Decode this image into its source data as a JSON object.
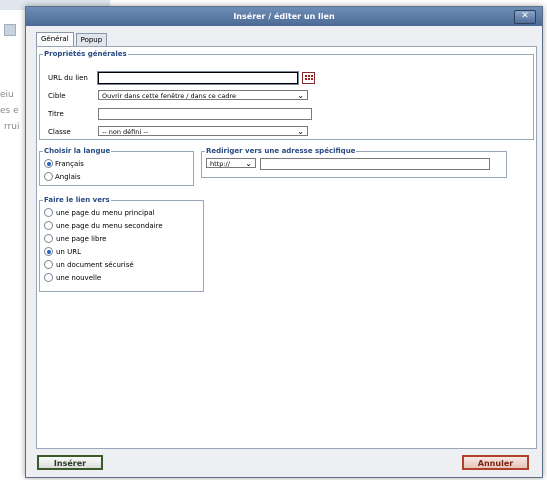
{
  "background": {
    "fragments": [
      "eiu",
      "es e",
      "rrui"
    ]
  },
  "dialog": {
    "title": "Insérer / éditer un lien",
    "close_label": "✕",
    "tabs": [
      {
        "label": "Général",
        "active": true
      },
      {
        "label": "Popup",
        "active": false
      }
    ],
    "general": {
      "legend": "Propriétés générales",
      "url_label": "URL du lien",
      "url_value": "",
      "target_label": "Cible",
      "target_value": "Ouvrir dans cette fenêtre / dans ce cadre",
      "title_label": "Titre",
      "title_value": "",
      "class_label": "Classe",
      "class_value": "-- non défini --"
    },
    "language": {
      "legend": "Choisir la langue",
      "options": [
        {
          "label": "Français",
          "checked": true
        },
        {
          "label": "Anglais",
          "checked": false
        }
      ]
    },
    "redirect": {
      "legend": "Rediriger vers une adresse spécifique",
      "protocol": "http://",
      "address": ""
    },
    "link_to": {
      "legend": "Faire le lien vers",
      "options": [
        {
          "label": "une page du menu principal",
          "checked": false
        },
        {
          "label": "une page du menu secondaire",
          "checked": false
        },
        {
          "label": "une page libre",
          "checked": false
        },
        {
          "label": "un URL",
          "checked": true
        },
        {
          "label": "un document sécurisé",
          "checked": false
        },
        {
          "label": "une nouvelle",
          "checked": false
        }
      ]
    },
    "buttons": {
      "insert": "Insérer",
      "cancel": "Annuler"
    },
    "colors": {
      "titlebar": "#5a7aa5",
      "legend": "#284b82",
      "radio_checked": "#2b62c0"
    },
    "icons": {
      "close": "close-icon",
      "browse": "browse-icon",
      "chevron": "chevron-down-icon"
    }
  }
}
